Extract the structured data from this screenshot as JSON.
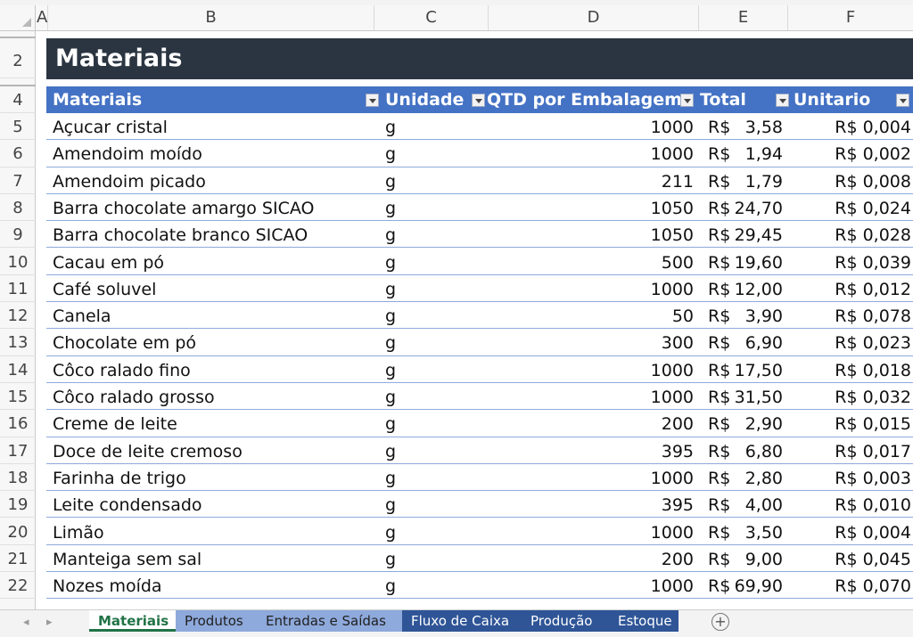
{
  "columns": [
    "A",
    "B",
    "C",
    "D",
    "E",
    "F"
  ],
  "row_numbers": [
    "2",
    "4",
    "5",
    "6",
    "7",
    "8",
    "9",
    "10",
    "11",
    "12",
    "13",
    "14",
    "15",
    "16",
    "17",
    "18",
    "19",
    "20",
    "21",
    "22"
  ],
  "title": "Materiais",
  "headers": {
    "materiais": "Materiais",
    "unidade": "Unidade",
    "qtd": "QTD por Embalagem",
    "total": "Total",
    "unitario": "Unitario"
  },
  "currency": "R$",
  "rows": [
    {
      "material": "Açucar cristal",
      "unidade": "g",
      "qtd": "1000",
      "total": "3,58",
      "unitario": "R$ 0,004"
    },
    {
      "material": "Amendoim moído",
      "unidade": "g",
      "qtd": "1000",
      "total": "1,94",
      "unitario": "R$ 0,002"
    },
    {
      "material": "Amendoim picado",
      "unidade": "g",
      "qtd": "211",
      "total": "1,79",
      "unitario": "R$ 0,008"
    },
    {
      "material": "Barra chocolate amargo SICAO",
      "unidade": "g",
      "qtd": "1050",
      "total": "24,70",
      "unitario": "R$ 0,024"
    },
    {
      "material": "Barra chocolate branco SICAO",
      "unidade": "g",
      "qtd": "1050",
      "total": "29,45",
      "unitario": "R$ 0,028"
    },
    {
      "material": "Cacau em pó",
      "unidade": "g",
      "qtd": "500",
      "total": "19,60",
      "unitario": "R$ 0,039"
    },
    {
      "material": "Café soluvel",
      "unidade": "g",
      "qtd": "1000",
      "total": "12,00",
      "unitario": "R$ 0,012"
    },
    {
      "material": "Canela",
      "unidade": "g",
      "qtd": "50",
      "total": "3,90",
      "unitario": "R$ 0,078"
    },
    {
      "material": "Chocolate em pó",
      "unidade": "g",
      "qtd": "300",
      "total": "6,90",
      "unitario": "R$ 0,023"
    },
    {
      "material": "Côco ralado fino",
      "unidade": "g",
      "qtd": "1000",
      "total": "17,50",
      "unitario": "R$ 0,018"
    },
    {
      "material": "Côco ralado grosso",
      "unidade": "g",
      "qtd": "1000",
      "total": "31,50",
      "unitario": "R$ 0,032"
    },
    {
      "material": "Creme de leite",
      "unidade": "g",
      "qtd": "200",
      "total": "2,90",
      "unitario": "R$ 0,015"
    },
    {
      "material": "Doce de leite cremoso",
      "unidade": "g",
      "qtd": "395",
      "total": "6,80",
      "unitario": "R$ 0,017"
    },
    {
      "material": "Farinha de trigo",
      "unidade": "g",
      "qtd": "1000",
      "total": "2,80",
      "unitario": "R$ 0,003"
    },
    {
      "material": "Leite condensado",
      "unidade": "g",
      "qtd": "395",
      "total": "4,00",
      "unitario": "R$ 0,010"
    },
    {
      "material": "Limão",
      "unidade": "g",
      "qtd": "1000",
      "total": "3,50",
      "unitario": "R$ 0,004"
    },
    {
      "material": "Manteiga sem sal",
      "unidade": "g",
      "qtd": "200",
      "total": "9,00",
      "unitario": "R$ 0,045"
    },
    {
      "material": "Nozes moída",
      "unidade": "g",
      "qtd": "1000",
      "total": "69,90",
      "unitario": "R$ 0,070"
    }
  ],
  "sheet_tabs": [
    {
      "label": "Materiais",
      "style": "active"
    },
    {
      "label": "Produtos",
      "style": "light"
    },
    {
      "label": "Entradas e Saídas",
      "style": "light"
    },
    {
      "label": "Fluxo de Caixa",
      "style": "dark"
    },
    {
      "label": "Produção",
      "style": "dark"
    },
    {
      "label": "Estoque",
      "style": "dark"
    }
  ],
  "add_sheet_label": "+",
  "colors": {
    "title_bg": "#2b3541",
    "header_bg": "#4472c4",
    "tab_light": "#8ea9db",
    "tab_dark": "#2f5597",
    "active_tab_text": "#217346"
  }
}
